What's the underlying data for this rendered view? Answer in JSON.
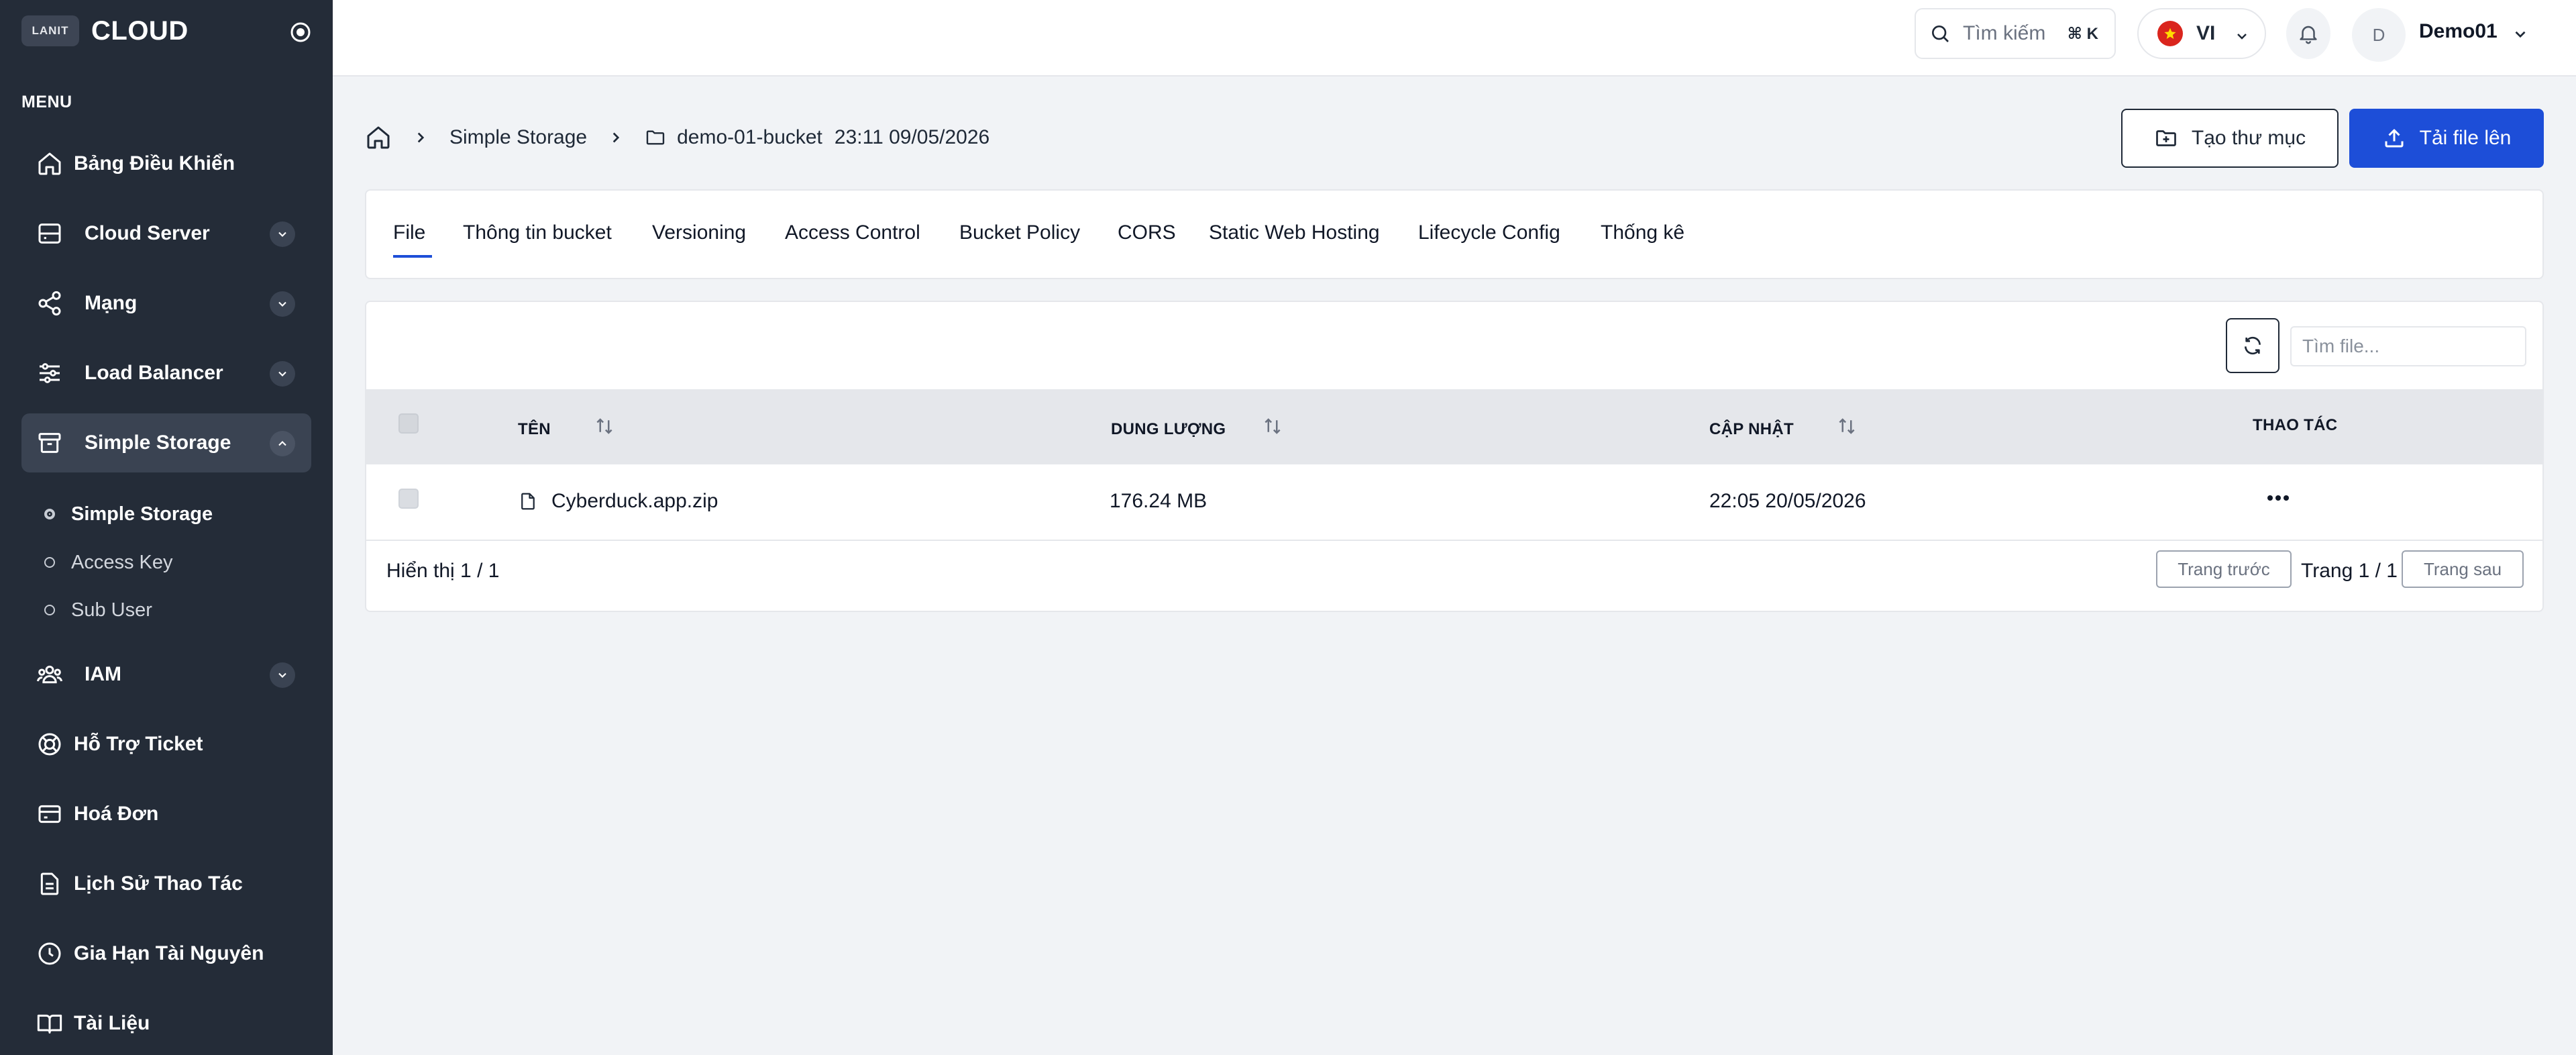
{
  "brand": {
    "logo_text": "LANIT",
    "name": "CLOUD"
  },
  "sidebar": {
    "menu_heading": "MENU",
    "items": [
      {
        "label": "Bảng Điều Khiển",
        "icon": "home-icon"
      },
      {
        "label": "Cloud Server",
        "icon": "server-icon",
        "expandable": true
      },
      {
        "label": "Mạng",
        "icon": "network-share-icon",
        "expandable": true
      },
      {
        "label": "Load Balancer",
        "icon": "sliders-icon",
        "expandable": true
      },
      {
        "label": "Simple Storage",
        "icon": "archive-box-icon",
        "expandable": true,
        "expanded": true,
        "active": true
      },
      {
        "label": "IAM",
        "icon": "users-icon",
        "expandable": true
      },
      {
        "label": "Hỗ Trợ Ticket",
        "icon": "lifebuoy-icon"
      },
      {
        "label": "Hoá Đơn",
        "icon": "credit-card-icon"
      },
      {
        "label": "Lịch Sử Thao Tác",
        "icon": "document-icon"
      },
      {
        "label": "Gia Hạn Tài Nguyên",
        "icon": "clock-icon"
      },
      {
        "label": "Tài Liệu",
        "icon": "book-icon"
      }
    ],
    "sub_items": [
      {
        "label": "Simple Storage",
        "active": true
      },
      {
        "label": "Access Key"
      },
      {
        "label": "Sub User"
      }
    ]
  },
  "topbar": {
    "search_label": "Tìm kiếm",
    "search_shortcut": "⌘ K",
    "language": "VI",
    "avatar_initial": "D",
    "username": "Demo01"
  },
  "breadcrumb": {
    "section": "Simple Storage",
    "bucket": "demo-01-bucket",
    "timestamp": "23:11 09/05/2026"
  },
  "actions": {
    "create_folder": "Tạo thư mục",
    "upload": "Tải file lên"
  },
  "tabs": [
    {
      "label": "File",
      "active": true
    },
    {
      "label": "Thông tin bucket"
    },
    {
      "label": "Versioning"
    },
    {
      "label": "Access Control"
    },
    {
      "label": "Bucket Policy"
    },
    {
      "label": "CORS"
    },
    {
      "label": "Static Web Hosting"
    },
    {
      "label": "Lifecycle Config"
    },
    {
      "label": "Thống kê"
    }
  ],
  "files": {
    "search_placeholder": "Tìm file...",
    "columns": {
      "name": "TÊN",
      "size": "DUNG LƯỢNG",
      "updated": "CẬP NHẬT",
      "actions": "THAO TÁC"
    },
    "rows": [
      {
        "name": "Cyberduck.app.zip",
        "size": "176.24 MB",
        "updated": "22:05 20/05/2026"
      }
    ],
    "summary": "Hiển thị 1 / 1",
    "pager": {
      "prev": "Trang trước",
      "info": "Trang 1 / 1",
      "next": "Trang sau"
    }
  },
  "colors": {
    "sidebar_bg": "#242c38",
    "primary": "#1d4ed8",
    "page_bg": "#f1f3f6"
  }
}
